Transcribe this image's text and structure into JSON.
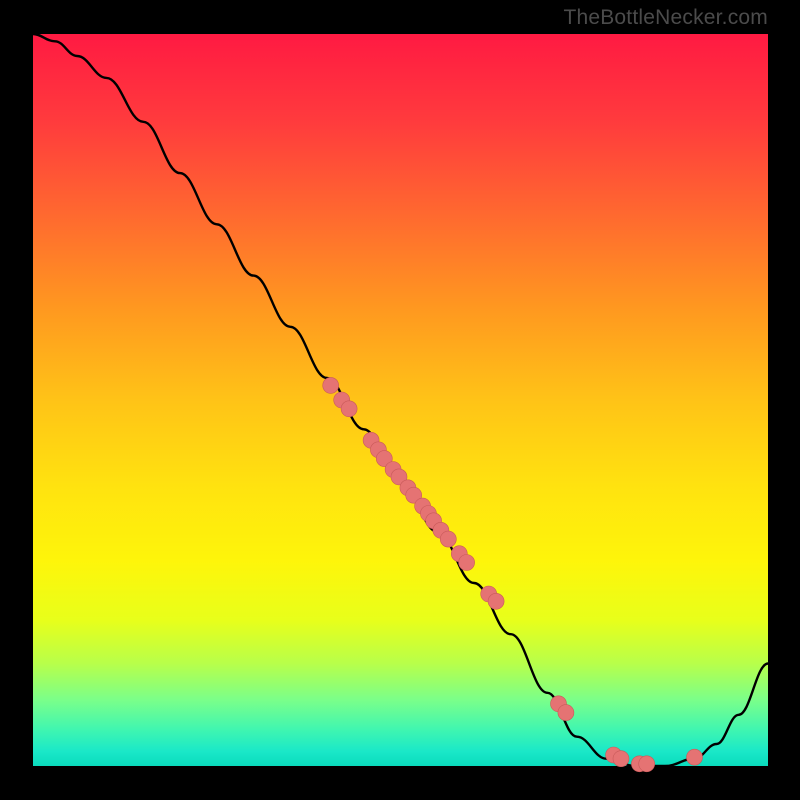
{
  "watermark": "TheBottleNecker.com",
  "colors": {
    "frame": "#000000",
    "gradient_top": "#ff1a42",
    "gradient_bottom": "#0adbbd",
    "curve": "#000000",
    "dot_fill": "#e57373",
    "dot_stroke": "#c95a5a"
  },
  "chart_data": {
    "type": "line",
    "title": "",
    "xlabel": "",
    "ylabel": "",
    "xlim": [
      0,
      100
    ],
    "ylim": [
      0,
      100
    ],
    "grid": false,
    "legend": false,
    "note": "Axis values are normalized (no tick labels visible in image). Y is bottleneck/penalty: 100 at top (red), 0 at bottom (green). Curve descends from top-left, reaches a flat minimum near x≈72-88, then rises toward x=100.",
    "series": [
      {
        "name": "curve",
        "x": [
          0,
          3,
          6,
          10,
          15,
          20,
          25,
          30,
          35,
          40,
          45,
          50,
          55,
          60,
          65,
          70,
          74,
          78,
          82,
          86,
          90,
          93,
          96,
          100
        ],
        "values": [
          100,
          99,
          97,
          94,
          88,
          81,
          74,
          67,
          60,
          53,
          46,
          39,
          32,
          25,
          18,
          10,
          4,
          1,
          0,
          0,
          1,
          3,
          7,
          14
        ]
      }
    ],
    "scatter": [
      {
        "name": "dots",
        "x": [
          40.5,
          42.0,
          43.0,
          46.0,
          47.0,
          47.8,
          49.0,
          49.8,
          51.0,
          51.8,
          53.0,
          53.8,
          54.5,
          55.5,
          56.5,
          58.0,
          59.0,
          62.0,
          63.0,
          71.5,
          72.5,
          79.0,
          80.0,
          82.5,
          83.5,
          90.0
        ],
        "values": [
          52.0,
          50.0,
          48.8,
          44.5,
          43.2,
          42.0,
          40.5,
          39.5,
          38.0,
          37.0,
          35.5,
          34.5,
          33.5,
          32.2,
          31.0,
          29.0,
          27.8,
          23.5,
          22.5,
          8.5,
          7.3,
          1.5,
          1.0,
          0.3,
          0.3,
          1.2
        ]
      }
    ]
  }
}
